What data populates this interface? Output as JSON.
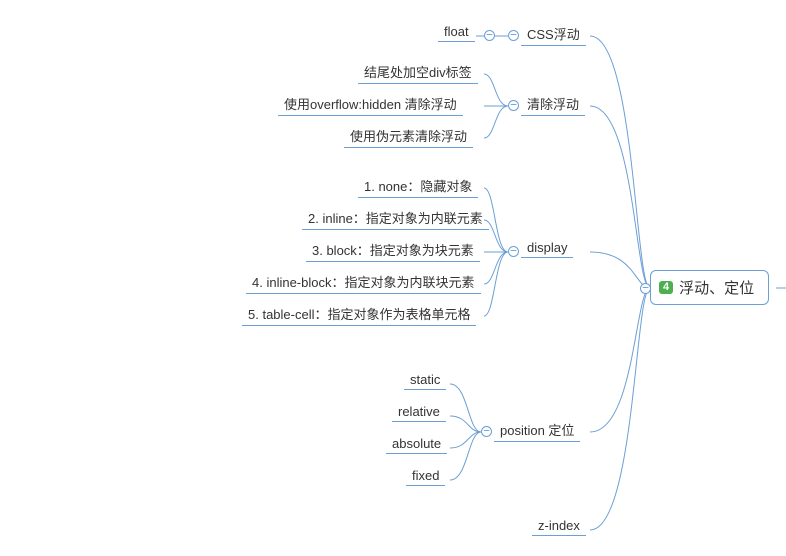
{
  "root": {
    "badge": "4",
    "title": "浮动、定位"
  },
  "branches": {
    "css_float": {
      "label": "CSS浮动",
      "children": {
        "float": "float"
      }
    },
    "clear_float": {
      "label": "清除浮动",
      "children": {
        "div": "结尾处加空div标签",
        "overflow": "使用overflow:hidden 清除浮动",
        "pseudo": "使用伪元素清除浮动"
      }
    },
    "display": {
      "label": "display",
      "children": {
        "none": "1. none：隐藏对象",
        "inline": "2. inline：指定对象为内联元素",
        "block": "3. block：指定对象为块元素",
        "inline_block": "4. inline-block：指定对象为内联块元素",
        "table_cell": "5. table-cell：指定对象作为表格单元格"
      }
    },
    "position": {
      "label": "position 定位",
      "children": {
        "static": "static",
        "relative": "relative",
        "absolute": "absolute",
        "fixed": "fixed"
      }
    },
    "z_index": {
      "label": "z-index"
    }
  },
  "toggle_symbol": "−"
}
